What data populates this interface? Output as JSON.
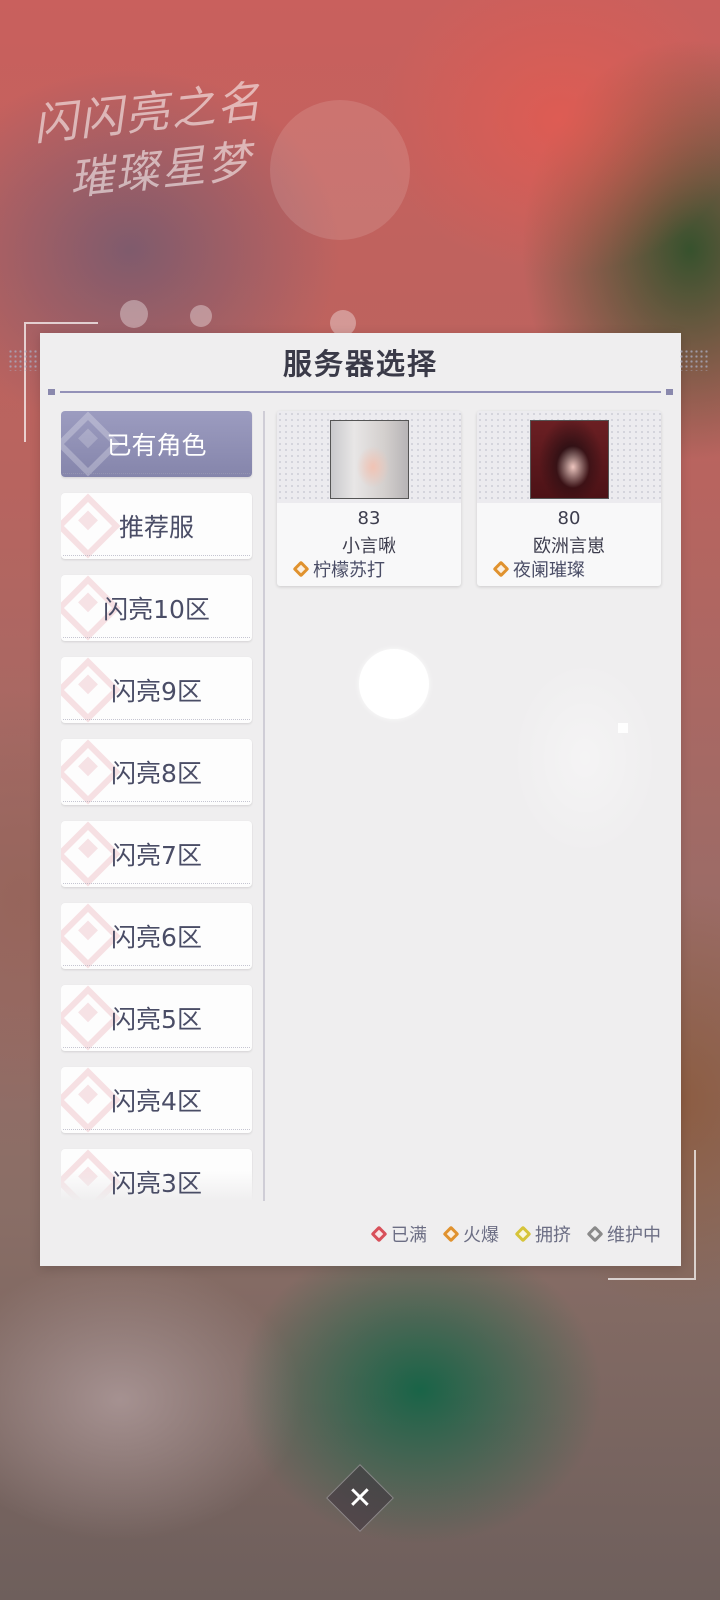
{
  "dialog": {
    "title": "服务器选择"
  },
  "sidebar": {
    "items": [
      {
        "label": "已有角色",
        "active": true
      },
      {
        "label": "推荐服"
      },
      {
        "label": "闪亮10区"
      },
      {
        "label": "闪亮9区"
      },
      {
        "label": "闪亮8区"
      },
      {
        "label": "闪亮7区"
      },
      {
        "label": "闪亮6区"
      },
      {
        "label": "闪亮5区"
      },
      {
        "label": "闪亮4区"
      },
      {
        "label": "闪亮3区"
      }
    ]
  },
  "roles": [
    {
      "level": "83",
      "name": "小言啾",
      "server": "柠檬苏打",
      "server_status": "hot",
      "avatar_icon": "character-avatar-white-hair"
    },
    {
      "level": "80",
      "name": "欧洲言崽",
      "server": "夜阑璀璨",
      "server_status": "hot",
      "avatar_icon": "character-avatar-dark-hair"
    }
  ],
  "legend": [
    {
      "label": "已满",
      "color": "#d8505a"
    },
    {
      "label": "火爆",
      "color": "#e0922f"
    },
    {
      "label": "拥挤",
      "color": "#d6c43a"
    },
    {
      "label": "维护中",
      "color": "#8a8a8a"
    }
  ],
  "background": {
    "logo_line1": "闪闪亮之名",
    "logo_line2": "璀璨星梦"
  }
}
